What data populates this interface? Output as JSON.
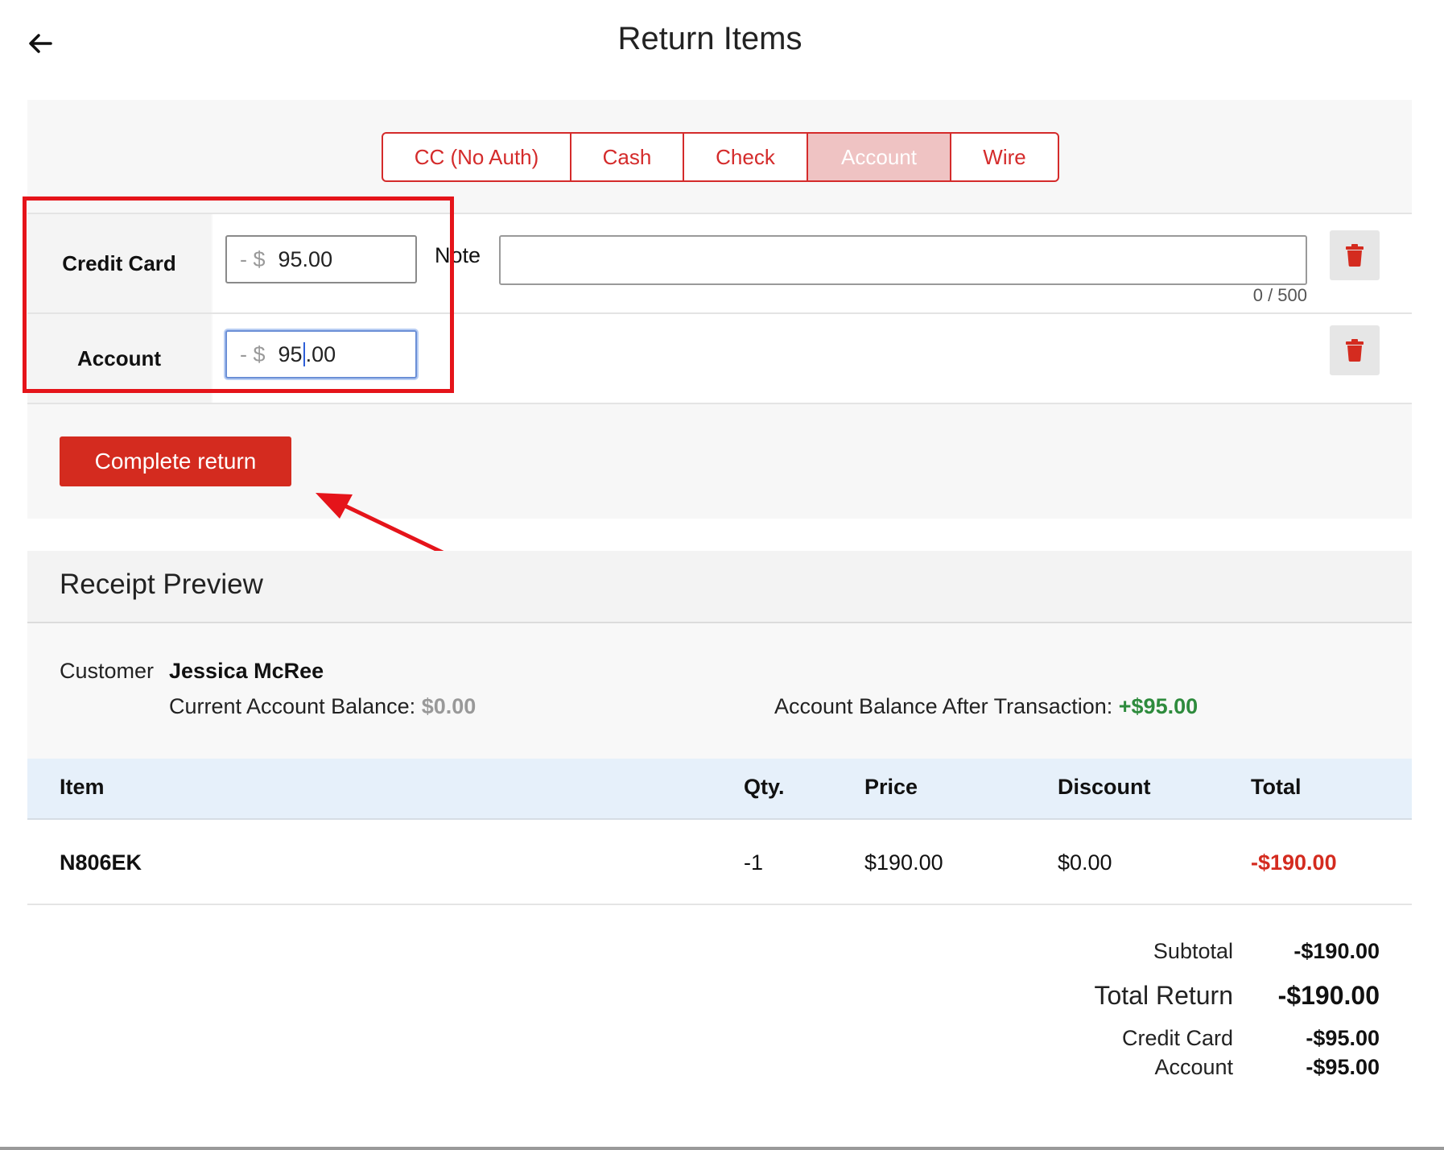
{
  "header": {
    "title": "Return Items"
  },
  "payment_methods": {
    "tabs": [
      {
        "label": "CC (No Auth)",
        "active": false
      },
      {
        "label": "Cash",
        "active": false
      },
      {
        "label": "Check",
        "active": false
      },
      {
        "label": "Account",
        "active": true
      },
      {
        "label": "Wire",
        "active": false
      }
    ]
  },
  "payments": [
    {
      "label": "Credit Card",
      "prefix": "- $",
      "amount": "95.00"
    },
    {
      "label": "Account",
      "prefix": "- $",
      "amount_before_caret": "95",
      "amount_after_caret": ".00"
    }
  ],
  "note": {
    "label": "Note",
    "value": "",
    "counter": "0 / 500"
  },
  "complete_button": {
    "label": "Complete return"
  },
  "receipt": {
    "title": "Receipt Preview",
    "customer_label": "Customer",
    "customer_name": "Jessica McRee",
    "current_balance_label": "Current Account Balance:",
    "current_balance": "$0.00",
    "after_balance_label": "Account Balance After Transaction:",
    "after_balance": "+$95.00",
    "columns": [
      "Item",
      "Qty.",
      "Price",
      "Discount",
      "Total"
    ],
    "rows": [
      {
        "item": "N806EK",
        "qty": "-1",
        "price": "$190.00",
        "discount": "$0.00",
        "total": "-$190.00"
      }
    ],
    "summary": {
      "subtotal_label": "Subtotal",
      "subtotal": "-$190.00",
      "total_label": "Total Return",
      "total": "-$190.00",
      "payments": [
        {
          "label": "Credit Card",
          "value": "-$95.00"
        },
        {
          "label": "Account",
          "value": "-$95.00"
        }
      ]
    }
  },
  "colors": {
    "accent": "#d42b2b",
    "positive": "#2e8b3d",
    "highlight": "#e5141a"
  }
}
